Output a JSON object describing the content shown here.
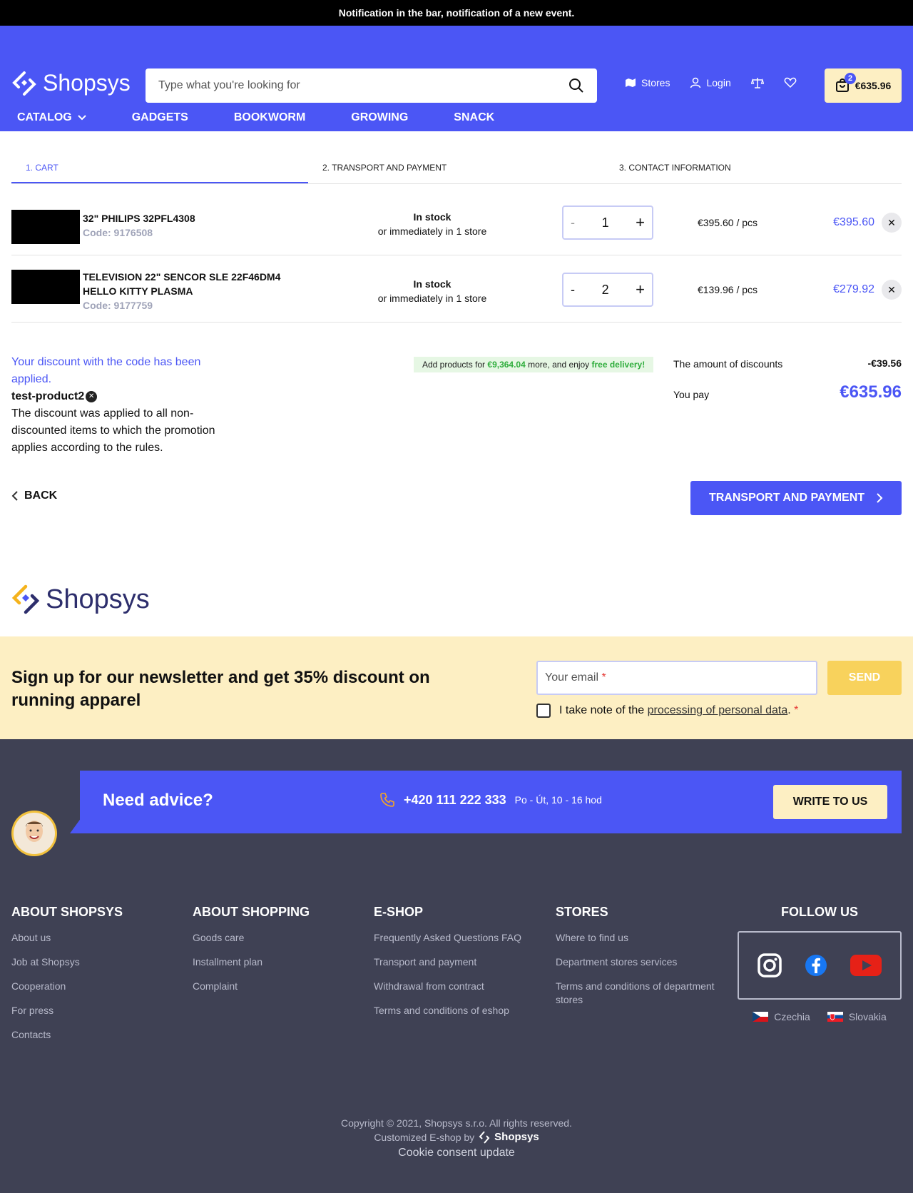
{
  "notification": "Notification in the bar, notification of a new event.",
  "header": {
    "logo": "Shopsys",
    "search_placeholder": "Type what you're looking for",
    "stores": "Stores",
    "login": "Login",
    "cart_count": "2",
    "cart_total": "€635.96"
  },
  "nav": {
    "items": [
      "CATALOG",
      "GADGETS",
      "BOOKWORM",
      "GROWING",
      "SNACK"
    ]
  },
  "steps": [
    "1. CART",
    "2. TRANSPORT AND PAYMENT",
    "3. CONTACT INFORMATION"
  ],
  "cart": {
    "items": [
      {
        "name": "32\" PHILIPS 32PFL4308",
        "code": "Code: 9176508",
        "stock": "In stock",
        "stock_sub": "or immediately in 1 store",
        "qty": "1",
        "unit_price": "€395.60 / pcs",
        "total": "€395.60"
      },
      {
        "name": "TELEVISION 22\" SENCOR SLE 22F46DM4 HELLO KITTY PLASMA",
        "code": "Code: 9177759",
        "stock": "In stock",
        "stock_sub": "or immediately in 1 store",
        "qty": "2",
        "unit_price": "€139.96 / pcs",
        "total": "€279.92"
      }
    ],
    "qty_minus": "-",
    "qty_plus": "+",
    "remove": "✕"
  },
  "discount": {
    "applied": "Your discount with the code has been applied.",
    "code": "test-product2",
    "note": "The discount was applied to all non-discounted items to which the promotion applies according to the rules."
  },
  "free_delivery": {
    "prefix": "Add products for ",
    "amount": "€9,364.04",
    "middle": " more, and enjoy ",
    "suffix": "free delivery!"
  },
  "summary": {
    "discounts_label": "The amount of discounts",
    "discounts_value": "-€39.56",
    "pay_label": "You pay",
    "pay_value": "€635.96"
  },
  "actions": {
    "back": "BACK",
    "next": "TRANSPORT AND PAYMENT"
  },
  "newsletter": {
    "title": "Sign up for our newsletter and get 35% discount on running apparel",
    "email_placeholder": "Your email",
    "send": "SEND",
    "consent_prefix": "I take note of the ",
    "consent_link": "processing of personal data",
    "consent_suffix": "."
  },
  "advice": {
    "title": "Need advice?",
    "phone": "+420 111 222 333",
    "hours": "Po - Út, 10 - 16 hod",
    "write": "WRITE TO US"
  },
  "footer": {
    "cols": [
      {
        "title": "ABOUT SHOPSYS",
        "links": [
          "About us",
          "Job at Shopsys",
          "Cooperation",
          "For press",
          "Contacts"
        ]
      },
      {
        "title": "ABOUT SHOPPING",
        "links": [
          "Goods care",
          "Installment plan",
          "Complaint"
        ]
      },
      {
        "title": "E-SHOP",
        "links": [
          "Frequently Asked Questions FAQ",
          "Transport and payment",
          "Withdrawal from contract",
          "Terms and conditions of eshop"
        ]
      },
      {
        "title": "STORES",
        "links": [
          "Where to find us",
          "Department stores services",
          "Terms and conditions of department stores"
        ]
      }
    ],
    "follow": "FOLLOW US",
    "langs": [
      "Czechia",
      "Slovakia"
    ],
    "copyright": "Copyright © 2021, Shopsys s.r.o. All rights reserved.",
    "customized": "Customized E-shop by",
    "brand": "Shopsys",
    "cookie": "Cookie consent update"
  },
  "colors": {
    "brand_blue": "#4b56f5",
    "cream": "#fdefc3",
    "footer_bg": "#3f4154",
    "green": "#2fad3c"
  }
}
